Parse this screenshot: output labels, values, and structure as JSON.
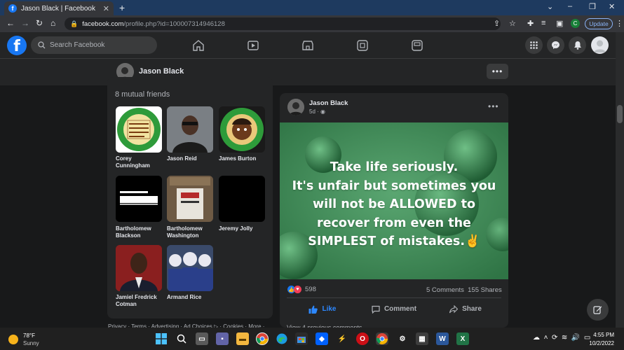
{
  "browser": {
    "tab_title": "Jason Black | Facebook",
    "tab_favicon": "f",
    "url_host": "facebook.com",
    "url_path": "/profile.php?id=100007314946128",
    "profile_initial": "C",
    "update_label": "Update"
  },
  "facebook": {
    "search_placeholder": "Search Facebook",
    "profile_name": "Jason Black",
    "accent_color": "#1877f2"
  },
  "friends": {
    "mutual_label": "8 mutual friends",
    "items": [
      {
        "name": "Corey Cunningham"
      },
      {
        "name": "Jason Reid"
      },
      {
        "name": "James Burton"
      },
      {
        "name": "Bartholomew Blackson"
      },
      {
        "name": "Bartholomew Washington"
      },
      {
        "name": "Jeremy Jolly"
      },
      {
        "name": "Jamiel Fredrick Cotman"
      },
      {
        "name": "Armand Rice"
      }
    ],
    "footer": "Privacy · Terms · Advertising · Ad Choices ▷ · Cookies · More ·"
  },
  "post": {
    "author": "Jason Black",
    "time": "5d ·",
    "quote_lines": [
      "Take life seriously.",
      "It's unfair but sometimes you",
      "will not be ALLOWED to",
      "recover from even the",
      "SIMPLEST of mistakes.✌️"
    ],
    "reaction_count": "598",
    "comments": "5 Comments",
    "shares": "155 Shares",
    "like_label": "Like",
    "comment_label": "Comment",
    "share_label": "Share",
    "previous_comments": "View 4 previous comments",
    "image_color": "#3e8a56"
  },
  "taskbar": {
    "temperature": "78°F",
    "condition": "Sunny",
    "time": "4:55 PM",
    "date": "10/2/2022"
  }
}
